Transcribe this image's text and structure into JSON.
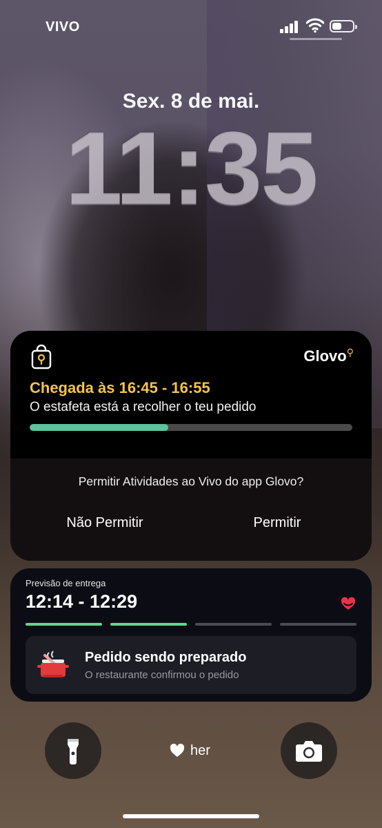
{
  "status_bar": {
    "carrier": "VIVO",
    "signal_bars": 4,
    "battery_level": 0.45
  },
  "lock_screen": {
    "date": "Sex. 8 de mai.",
    "time": "11:35"
  },
  "live_activity": {
    "brand": "Glovo",
    "arrival_text": "Chegada às 16:45 - 16:55",
    "status_text": "O estafeta está a recolher o teu pedido",
    "progress": 0.43,
    "accent_color": "#f6c24f",
    "progress_color": "#5cc39a",
    "permission": {
      "question": "Permitir Atividades ao Vivo do app Glovo?",
      "deny_label": "Não Permitir",
      "allow_label": "Permitir"
    }
  },
  "delivery": {
    "eta_label": "Previsão de entrega",
    "eta_range": "12:14 - 12:29",
    "steps_done": 2,
    "steps_total": 4,
    "status_title": "Pedido sendo preparado",
    "status_subtitle": "O restaurante confirmou o pedido",
    "icons": [
      "cooking-pot-icon",
      "brand-heart-icon"
    ]
  },
  "bottom": {
    "focus_label": "her",
    "icons": [
      "flashlight-icon",
      "heart-icon",
      "camera-icon"
    ]
  }
}
